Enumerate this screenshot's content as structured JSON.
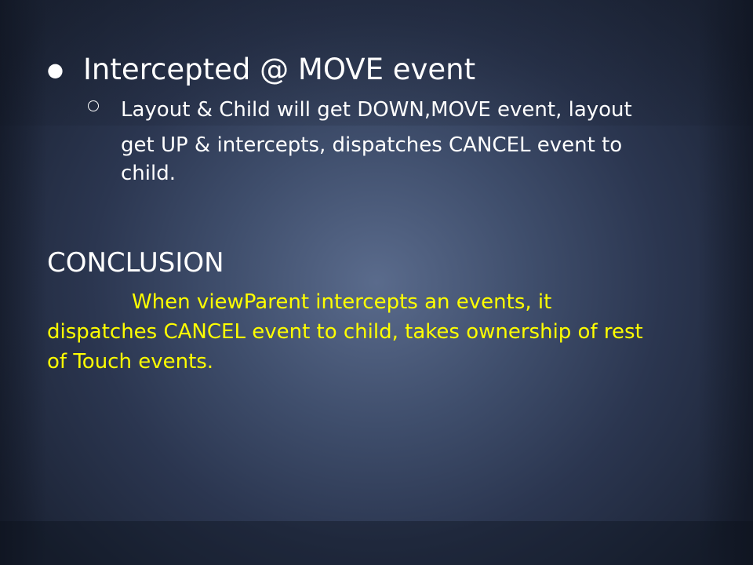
{
  "slide": {
    "bullet": "Intercepted @ MOVE event",
    "sub_bullet": {
      "line1": "Layout & Child will get DOWN,MOVE event, layout",
      "line2": "get UP & intercepts, dispatches CANCEL event to",
      "line3": "child."
    },
    "heading": "CONCLUSION",
    "conclusion": {
      "line1": "When viewParent intercepts an events, it",
      "line2": "dispatches CANCEL event to child, takes ownership of rest",
      "line3": "of Touch events."
    },
    "colors": {
      "text": "#ffffff",
      "highlight": "#ffff00",
      "background": "#3f4e6c"
    }
  }
}
